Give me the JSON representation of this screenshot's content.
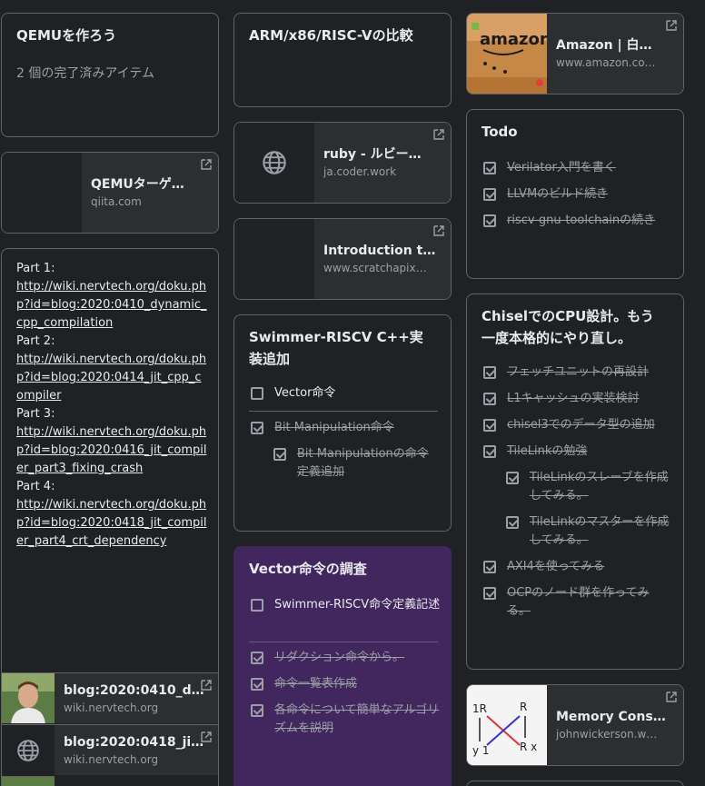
{
  "col1": {
    "note1": {
      "title": "QEMUを作ろう",
      "subtitle": "2 個の完了済みアイテム"
    },
    "link1": {
      "title": "QEMUターゲ…",
      "url": "qiita.com"
    },
    "wiki": {
      "p1_label": "Part 1:",
      "p1_link": "http://wiki.nervtech.org/doku.php?id=blog:2020:0410_dynamic_cpp_compilation",
      "p2_label": "Part 2:",
      "p2_link": "http://wiki.nervtech.org/doku.php?id=blog:2020:0414_jit_cpp_compiler",
      "p3_label": "Part 3:",
      "p3_link": "http://wiki.nervtech.org/doku.php?id=blog:2020:0416_jit_compiler_part3_fixing_crash",
      "p4_label": "Part 4:",
      "p4_link": "http://wiki.nervtech.org/doku.php?id=blog:2020:0418_jit_compiler_part4_crt_dependency",
      "preview1": {
        "title": "blog:2020:0410_d…",
        "url": "wiki.nervtech.org"
      },
      "preview2": {
        "title": "blog:2020:0418_ji…",
        "url": "wiki.nervtech.org"
      }
    }
  },
  "col2": {
    "note1": {
      "title": "ARM/x86/RISC-Vの比較"
    },
    "link1": {
      "title": "ruby - ルビー…",
      "url": "ja.coder.work"
    },
    "link2": {
      "title": "Introduction t…",
      "url": "www.scratchapix…"
    },
    "swimmer": {
      "title": "Swimmer-RISCV C++実装追加",
      "items": [
        {
          "text": "Vector命令"
        },
        {
          "text": "Bit Manipulation命令"
        },
        {
          "text": "Bit Manipulationの命令定義追加"
        }
      ]
    },
    "vector": {
      "title": "Vector命令の調査",
      "items": [
        {
          "text": "Swimmer-RISCV命令定義記述"
        },
        {
          "text": "リダクション命令から。"
        },
        {
          "text": "命令一覧表作成"
        },
        {
          "text": "各命令について簡単なアルゴリズムを説明"
        }
      ]
    }
  },
  "col3": {
    "link1": {
      "title": "Amazon | 白…",
      "url": "www.amazon.co…"
    },
    "todo": {
      "title": "Todo",
      "items": [
        {
          "text": "Verilator入門を書く"
        },
        {
          "text": "LLVMのビルド続き"
        },
        {
          "text": "riscv-gnu-toolchainの続き"
        }
      ]
    },
    "chisel": {
      "title": "ChiselでのCPU設計。もう一度本格的にやり直し。",
      "items": [
        {
          "text": "フェッチユニットの再設計"
        },
        {
          "text": "L1キャッシュの実装検討"
        },
        {
          "text": "chisel3でのデータ型の追加"
        },
        {
          "text": "TileLinkの勉強"
        },
        {
          "text": "TileLinkのスレーブを作成してみる。"
        },
        {
          "text": "TileLinkのマスターを作成してみる。"
        },
        {
          "text": "AXI4を使ってみる"
        },
        {
          "text": "OCPのノード群を作ってみる。"
        }
      ]
    },
    "link2": {
      "title": "Memory Cons…",
      "url": "johnwickerson.w…"
    }
  },
  "colors": {
    "background": "#202124",
    "card_border": "#5f6368",
    "purple_note": "#42275e",
    "muted": "#9aa0a6"
  }
}
